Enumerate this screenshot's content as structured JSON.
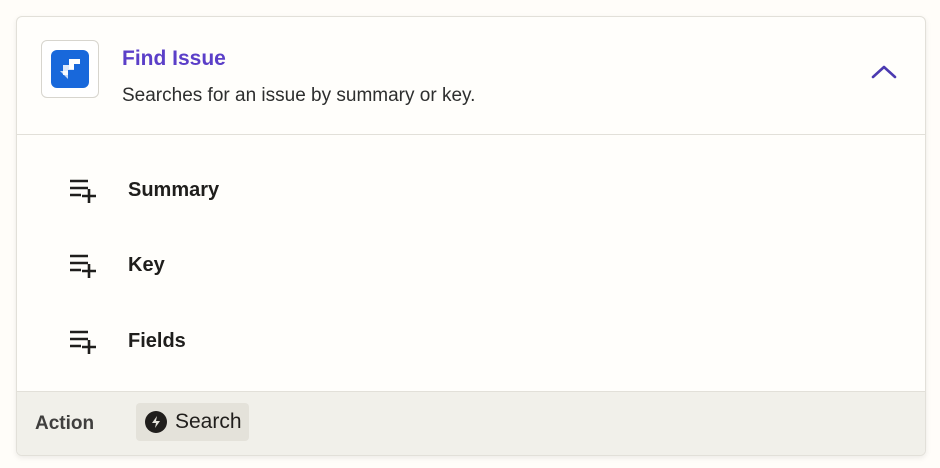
{
  "step": {
    "app_icon": "jira-icon",
    "title": "Find Issue",
    "description": "Searches for an issue by summary or key.",
    "collapse_icon": "chevron-up-icon"
  },
  "fields": [
    {
      "label": "Summary",
      "icon": "playlist-add-icon"
    },
    {
      "label": "Key",
      "icon": "playlist-add-icon"
    },
    {
      "label": "Fields",
      "icon": "playlist-add-icon"
    }
  ],
  "footer": {
    "label": "Action",
    "chip_label": "Search",
    "chip_icon": "bolt-icon"
  },
  "colors": {
    "title": "#5b3fc8",
    "jira_blue": "#1868db",
    "footer_bg": "#f1f0ea"
  }
}
